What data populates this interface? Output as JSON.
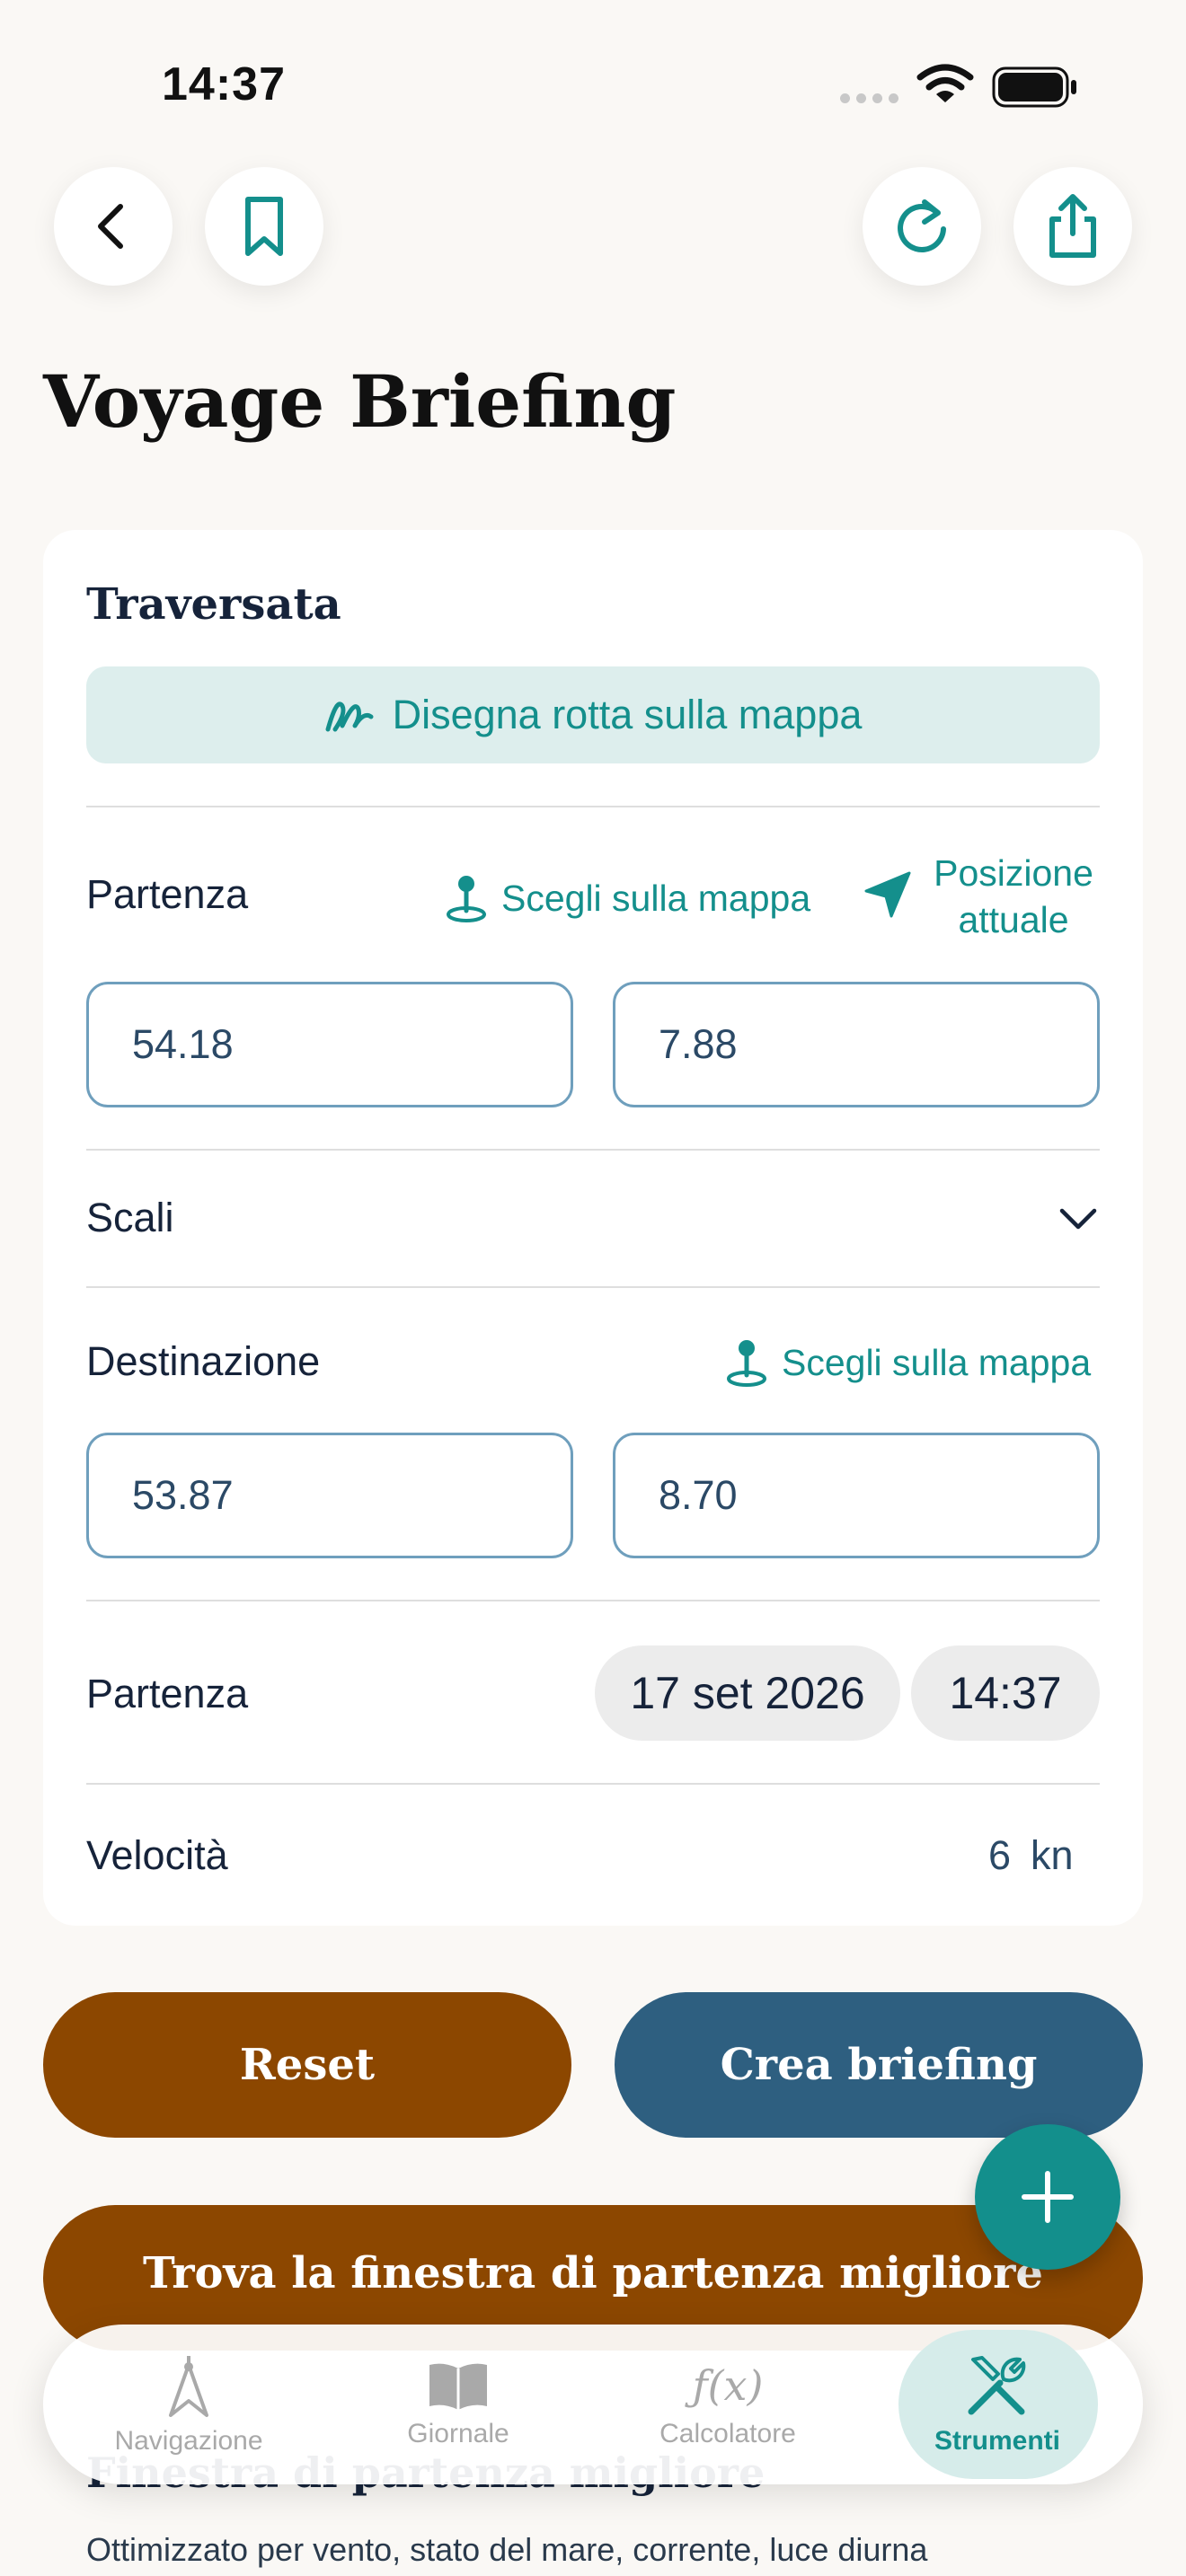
{
  "status_bar": {
    "time": "14:37"
  },
  "header": {
    "title": "Voyage Briefing",
    "buttons": {
      "back": "chevron-left-icon",
      "bookmark": "bookmark-icon",
      "refresh": "refresh-icon",
      "share": "share-icon"
    }
  },
  "card": {
    "title": "Traversata",
    "draw_route_label": "Disegna rotta sulla mappa",
    "departure": {
      "label": "Partenza",
      "pick_on_map": "Scegli sulla mappa",
      "current_position_line1": "Posizione",
      "current_position_line2": "attuale",
      "lat": "54.18",
      "lon": "7.88"
    },
    "stops": {
      "label": "Scali"
    },
    "destination": {
      "label": "Destinazione",
      "pick_on_map": "Scegli sulla mappa",
      "lat": "53.87",
      "lon": "8.70"
    },
    "departure_time": {
      "label": "Partenza",
      "date": "17 set 2026",
      "time": "14:37"
    },
    "speed": {
      "label": "Velocità",
      "value": "6",
      "unit": "kn"
    }
  },
  "actions": {
    "reset": "Reset",
    "create": "Crea briefing",
    "find_window": "Trova la finestra di partenza migliore"
  },
  "tabbar": {
    "tabs": [
      {
        "label": "Navigazione",
        "icon": "compass-icon"
      },
      {
        "label": "Giornale",
        "icon": "book-icon"
      },
      {
        "label": "Calcolatore",
        "icon": "function-icon"
      },
      {
        "label": "Strumenti",
        "icon": "tools-icon"
      }
    ],
    "active": "Strumenti"
  },
  "below": {
    "heading": "Finestra di partenza migliore",
    "text": "Ottimizzato per vento, stato del mare, corrente, luce diurna"
  },
  "colors": {
    "accent": "#138f8c",
    "brown": "#8c4700",
    "navy": "#2e5f80",
    "background": "#faf8f5"
  }
}
